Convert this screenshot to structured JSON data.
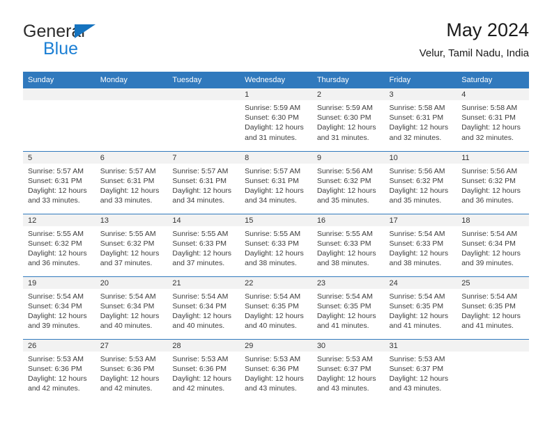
{
  "brand": {
    "word1": "General",
    "word2": "Blue",
    "color_dark": "#2b2b2b",
    "color_blue": "#1b7fd4"
  },
  "header": {
    "title": "May 2024",
    "location": "Velur, Tamil Nadu, India"
  },
  "theme": {
    "header_blue": "#3079bd",
    "band_gray": "#f2f2f2",
    "text": "#3c3c3c"
  },
  "weekdays": [
    "Sunday",
    "Monday",
    "Tuesday",
    "Wednesday",
    "Thursday",
    "Friday",
    "Saturday"
  ],
  "weeks": [
    [
      {
        "day": "",
        "lines": []
      },
      {
        "day": "",
        "lines": []
      },
      {
        "day": "",
        "lines": []
      },
      {
        "day": "1",
        "lines": [
          "Sunrise: 5:59 AM",
          "Sunset: 6:30 PM",
          "Daylight: 12 hours",
          "and 31 minutes."
        ]
      },
      {
        "day": "2",
        "lines": [
          "Sunrise: 5:59 AM",
          "Sunset: 6:30 PM",
          "Daylight: 12 hours",
          "and 31 minutes."
        ]
      },
      {
        "day": "3",
        "lines": [
          "Sunrise: 5:58 AM",
          "Sunset: 6:31 PM",
          "Daylight: 12 hours",
          "and 32 minutes."
        ]
      },
      {
        "day": "4",
        "lines": [
          "Sunrise: 5:58 AM",
          "Sunset: 6:31 PM",
          "Daylight: 12 hours",
          "and 32 minutes."
        ]
      }
    ],
    [
      {
        "day": "5",
        "lines": [
          "Sunrise: 5:57 AM",
          "Sunset: 6:31 PM",
          "Daylight: 12 hours",
          "and 33 minutes."
        ]
      },
      {
        "day": "6",
        "lines": [
          "Sunrise: 5:57 AM",
          "Sunset: 6:31 PM",
          "Daylight: 12 hours",
          "and 33 minutes."
        ]
      },
      {
        "day": "7",
        "lines": [
          "Sunrise: 5:57 AM",
          "Sunset: 6:31 PM",
          "Daylight: 12 hours",
          "and 34 minutes."
        ]
      },
      {
        "day": "8",
        "lines": [
          "Sunrise: 5:57 AM",
          "Sunset: 6:31 PM",
          "Daylight: 12 hours",
          "and 34 minutes."
        ]
      },
      {
        "day": "9",
        "lines": [
          "Sunrise: 5:56 AM",
          "Sunset: 6:32 PM",
          "Daylight: 12 hours",
          "and 35 minutes."
        ]
      },
      {
        "day": "10",
        "lines": [
          "Sunrise: 5:56 AM",
          "Sunset: 6:32 PM",
          "Daylight: 12 hours",
          "and 35 minutes."
        ]
      },
      {
        "day": "11",
        "lines": [
          "Sunrise: 5:56 AM",
          "Sunset: 6:32 PM",
          "Daylight: 12 hours",
          "and 36 minutes."
        ]
      }
    ],
    [
      {
        "day": "12",
        "lines": [
          "Sunrise: 5:55 AM",
          "Sunset: 6:32 PM",
          "Daylight: 12 hours",
          "and 36 minutes."
        ]
      },
      {
        "day": "13",
        "lines": [
          "Sunrise: 5:55 AM",
          "Sunset: 6:32 PM",
          "Daylight: 12 hours",
          "and 37 minutes."
        ]
      },
      {
        "day": "14",
        "lines": [
          "Sunrise: 5:55 AM",
          "Sunset: 6:33 PM",
          "Daylight: 12 hours",
          "and 37 minutes."
        ]
      },
      {
        "day": "15",
        "lines": [
          "Sunrise: 5:55 AM",
          "Sunset: 6:33 PM",
          "Daylight: 12 hours",
          "and 38 minutes."
        ]
      },
      {
        "day": "16",
        "lines": [
          "Sunrise: 5:55 AM",
          "Sunset: 6:33 PM",
          "Daylight: 12 hours",
          "and 38 minutes."
        ]
      },
      {
        "day": "17",
        "lines": [
          "Sunrise: 5:54 AM",
          "Sunset: 6:33 PM",
          "Daylight: 12 hours",
          "and 38 minutes."
        ]
      },
      {
        "day": "18",
        "lines": [
          "Sunrise: 5:54 AM",
          "Sunset: 6:34 PM",
          "Daylight: 12 hours",
          "and 39 minutes."
        ]
      }
    ],
    [
      {
        "day": "19",
        "lines": [
          "Sunrise: 5:54 AM",
          "Sunset: 6:34 PM",
          "Daylight: 12 hours",
          "and 39 minutes."
        ]
      },
      {
        "day": "20",
        "lines": [
          "Sunrise: 5:54 AM",
          "Sunset: 6:34 PM",
          "Daylight: 12 hours",
          "and 40 minutes."
        ]
      },
      {
        "day": "21",
        "lines": [
          "Sunrise: 5:54 AM",
          "Sunset: 6:34 PM",
          "Daylight: 12 hours",
          "and 40 minutes."
        ]
      },
      {
        "day": "22",
        "lines": [
          "Sunrise: 5:54 AM",
          "Sunset: 6:35 PM",
          "Daylight: 12 hours",
          "and 40 minutes."
        ]
      },
      {
        "day": "23",
        "lines": [
          "Sunrise: 5:54 AM",
          "Sunset: 6:35 PM",
          "Daylight: 12 hours",
          "and 41 minutes."
        ]
      },
      {
        "day": "24",
        "lines": [
          "Sunrise: 5:54 AM",
          "Sunset: 6:35 PM",
          "Daylight: 12 hours",
          "and 41 minutes."
        ]
      },
      {
        "day": "25",
        "lines": [
          "Sunrise: 5:54 AM",
          "Sunset: 6:35 PM",
          "Daylight: 12 hours",
          "and 41 minutes."
        ]
      }
    ],
    [
      {
        "day": "26",
        "lines": [
          "Sunrise: 5:53 AM",
          "Sunset: 6:36 PM",
          "Daylight: 12 hours",
          "and 42 minutes."
        ]
      },
      {
        "day": "27",
        "lines": [
          "Sunrise: 5:53 AM",
          "Sunset: 6:36 PM",
          "Daylight: 12 hours",
          "and 42 minutes."
        ]
      },
      {
        "day": "28",
        "lines": [
          "Sunrise: 5:53 AM",
          "Sunset: 6:36 PM",
          "Daylight: 12 hours",
          "and 42 minutes."
        ]
      },
      {
        "day": "29",
        "lines": [
          "Sunrise: 5:53 AM",
          "Sunset: 6:36 PM",
          "Daylight: 12 hours",
          "and 43 minutes."
        ]
      },
      {
        "day": "30",
        "lines": [
          "Sunrise: 5:53 AM",
          "Sunset: 6:37 PM",
          "Daylight: 12 hours",
          "and 43 minutes."
        ]
      },
      {
        "day": "31",
        "lines": [
          "Sunrise: 5:53 AM",
          "Sunset: 6:37 PM",
          "Daylight: 12 hours",
          "and 43 minutes."
        ]
      },
      {
        "day": "",
        "lines": []
      }
    ]
  ]
}
